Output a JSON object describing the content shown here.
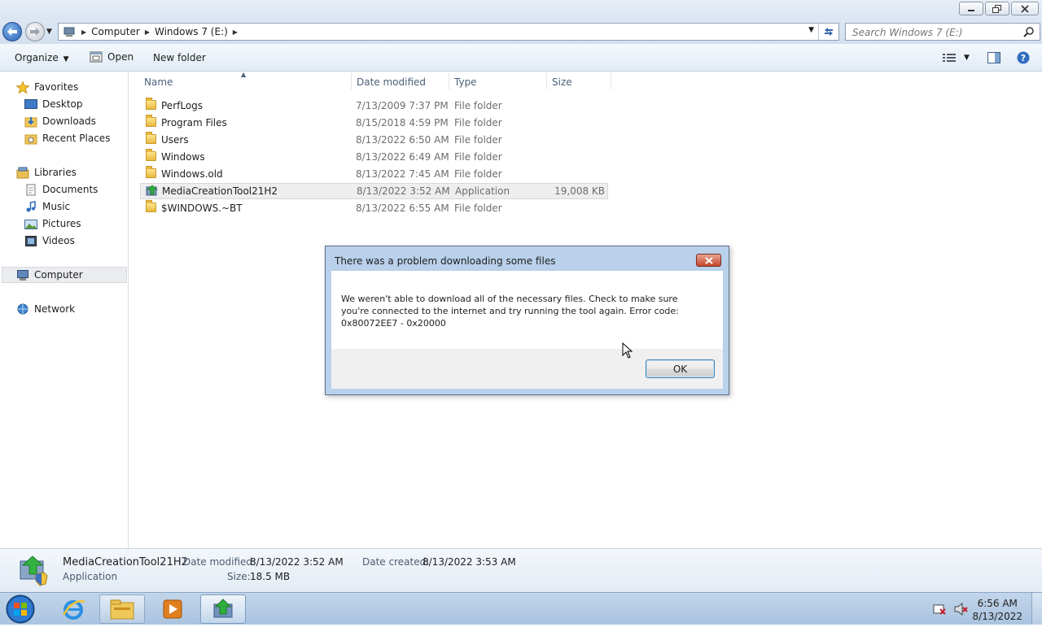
{
  "window": {
    "caption_buttons": [
      "minimize",
      "maximize",
      "close"
    ]
  },
  "address_bar": {
    "crumbs": [
      "Computer",
      "Windows 7 (E:)"
    ],
    "search_placeholder": "Search Windows 7 (E:)"
  },
  "toolbar": {
    "organize": "Organize",
    "open": "Open",
    "new_folder": "New folder"
  },
  "nav_pane": {
    "favorites": "Favorites",
    "favorites_items": [
      "Desktop",
      "Downloads",
      "Recent Places"
    ],
    "libraries": "Libraries",
    "libraries_items": [
      "Documents",
      "Music",
      "Pictures",
      "Videos"
    ],
    "computer": "Computer",
    "network": "Network"
  },
  "columns": {
    "name": "Name",
    "date_modified": "Date modified",
    "type": "Type",
    "size": "Size"
  },
  "files": [
    {
      "name": "PerfLogs",
      "date": "7/13/2009 7:37 PM",
      "type": "File folder",
      "size": ""
    },
    {
      "name": "Program Files",
      "date": "8/15/2018 4:59 PM",
      "type": "File folder",
      "size": ""
    },
    {
      "name": "Users",
      "date": "8/13/2022 6:50 AM",
      "type": "File folder",
      "size": ""
    },
    {
      "name": "Windows",
      "date": "8/13/2022 6:49 AM",
      "type": "File folder",
      "size": ""
    },
    {
      "name": "Windows.old",
      "date": "8/13/2022 7:45 AM",
      "type": "File folder",
      "size": ""
    },
    {
      "name": "MediaCreationTool21H2",
      "date": "8/13/2022 3:52 AM",
      "type": "Application",
      "size": "19,008 KB"
    },
    {
      "name": "$WINDOWS.~BT",
      "date": "8/13/2022 6:55 AM",
      "type": "File folder",
      "size": ""
    }
  ],
  "details_pane": {
    "name": "MediaCreationTool21H2",
    "type": "Application",
    "date_modified_label": "Date modified:",
    "date_modified": "8/13/2022 3:52 AM",
    "date_created_label": "Date created:",
    "date_created": "8/13/2022 3:53 AM",
    "size_label": "Size:",
    "size": "18.5 MB"
  },
  "dialog": {
    "title": "There was a problem downloading some files",
    "message": "We weren't able to download all of the necessary files. Check to make sure you're connected to the internet and try running the tool again. Error code: 0x80072EE7 - 0x20000",
    "ok": "OK"
  },
  "taskbar": {
    "time": "6:56 AM",
    "date": "8/13/2022"
  },
  "colors": {
    "taskbar": "#aac3df",
    "dialog_frame": "#b9d1ea",
    "close_red": "#c4472b"
  }
}
